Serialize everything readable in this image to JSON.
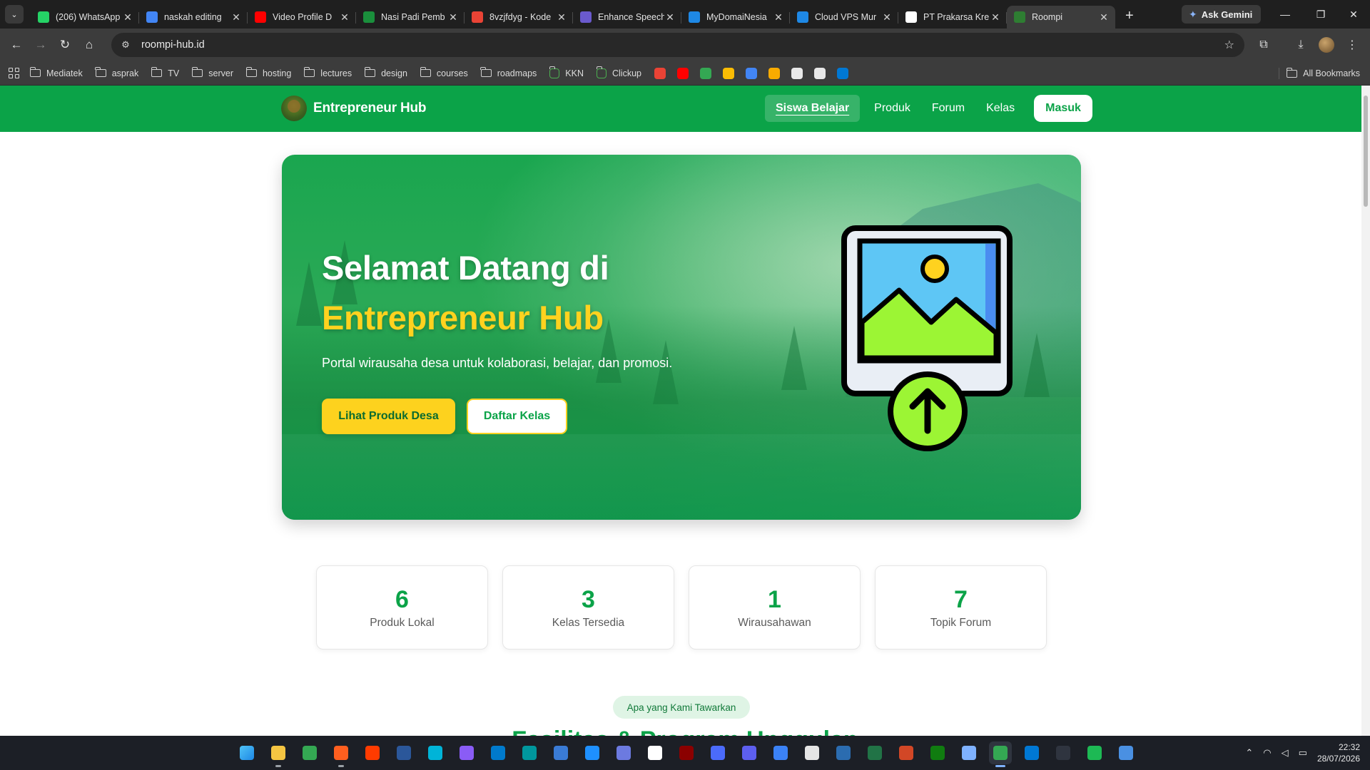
{
  "browser": {
    "tabs": [
      {
        "title": "(206) WhatsApp",
        "favicon_color": "#25d366",
        "icon": "whatsapp-icon"
      },
      {
        "title": "naskah editing",
        "favicon_color": "#4285f4",
        "icon": "docs-icon"
      },
      {
        "title": "Video Profile D",
        "favicon_color": "#ff0000",
        "icon": "youtube-icon"
      },
      {
        "title": "Nasi Padi Pemb",
        "favicon_color": "#1a8f3c",
        "icon": "px-icon"
      },
      {
        "title": "8vzjfdyg - Kode",
        "favicon_color": "#ea4335",
        "icon": "gmail-icon"
      },
      {
        "title": "Enhance Speech",
        "favicon_color": "#6a5acd",
        "icon": "adobe-icon"
      },
      {
        "title": "MyDomaiNesia",
        "favicon_color": "#1e88e5",
        "icon": "domainesia-icon"
      },
      {
        "title": "Cloud VPS Mur",
        "favicon_color": "#1e88e5",
        "icon": "domainesia-icon"
      },
      {
        "title": "PT Prakarsa Kre",
        "favicon_color": "#ffffff",
        "icon": "prakarsa-icon"
      },
      {
        "title": "Roompi",
        "favicon_color": "#2e7d32",
        "icon": "roompi-icon",
        "active": true
      }
    ],
    "new_tab_symbol": "+",
    "gemini_label": "Ask Gemini",
    "url": "roompi-hub.id",
    "bookmarks": [
      {
        "label": "Mediatek",
        "type": "folder"
      },
      {
        "label": "asprak",
        "type": "folder"
      },
      {
        "label": "TV",
        "type": "folder"
      },
      {
        "label": "server",
        "type": "folder"
      },
      {
        "label": "hosting",
        "type": "folder"
      },
      {
        "label": "lectures",
        "type": "folder"
      },
      {
        "label": "design",
        "type": "folder"
      },
      {
        "label": "courses",
        "type": "folder"
      },
      {
        "label": "roadmaps",
        "type": "folder"
      },
      {
        "label": "KKN",
        "type": "link"
      },
      {
        "label": "Clickup",
        "type": "link"
      }
    ],
    "bookmark_icons": [
      "#ea4335",
      "#ff0000",
      "#34a853",
      "#fbbc04",
      "#4285f4",
      "#f9ab00",
      "#e8e8e8",
      "#e8e8e8",
      "#0078d4"
    ],
    "all_bookmarks_label": "All Bookmarks"
  },
  "site": {
    "brand": "Entrepreneur Hub",
    "nav": {
      "items": [
        "Siswa Belajar",
        "Produk",
        "Forum",
        "Kelas"
      ],
      "active": "Siswa Belajar",
      "login": "Masuk"
    },
    "hero": {
      "title_line1": "Selamat Datang di",
      "title_line2": "Entrepreneur Hub",
      "subtitle": "Portal wirausaha desa untuk kolaborasi, belajar, dan promosi.",
      "primary_cta": "Lihat Produk Desa",
      "secondary_cta": "Daftar Kelas"
    },
    "stats": [
      {
        "value": "6",
        "label": "Produk Lokal"
      },
      {
        "value": "3",
        "label": "Kelas Tersedia"
      },
      {
        "value": "1",
        "label": "Wirausahawan"
      },
      {
        "value": "7",
        "label": "Topik Forum"
      }
    ],
    "section_badge": "Apa yang Kami Tawarkan",
    "section_title_peek": "Fasilitas & Program Unggulan",
    "colors": {
      "primary": "#0ba348",
      "accent": "#ffd21f"
    }
  },
  "taskbar": {
    "time": "22:32",
    "date": "28/07/2026"
  }
}
